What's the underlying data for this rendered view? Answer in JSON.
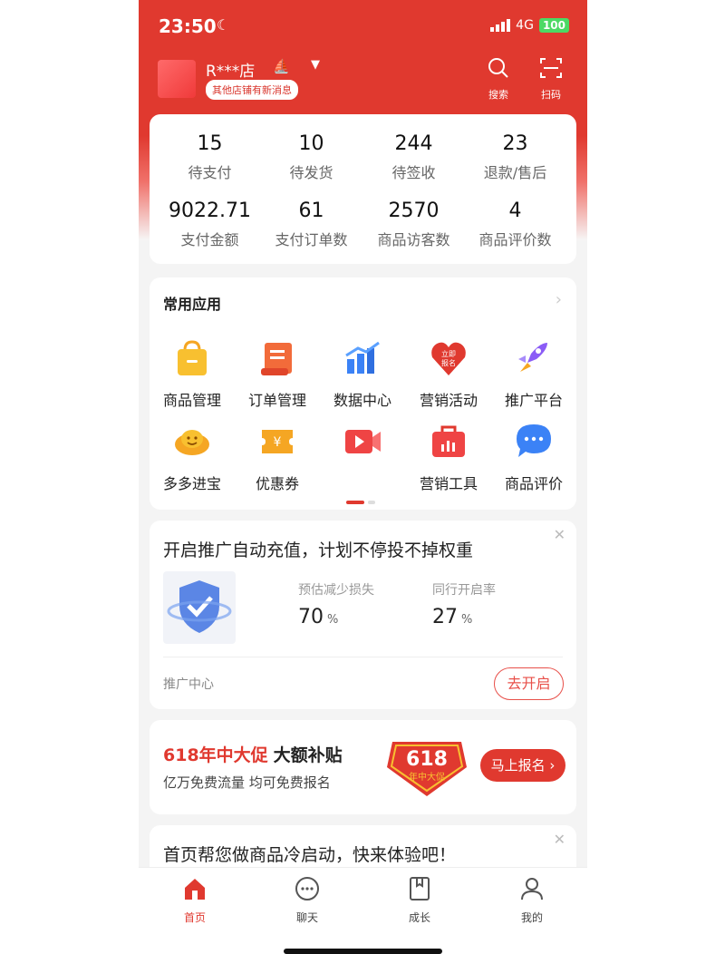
{
  "status_bar": {
    "time": "23:50",
    "network": "4G",
    "battery": "100"
  },
  "header": {
    "shop_name": "R***店",
    "shop_tag": "其他店铺有新消息",
    "search_label": "搜索",
    "scan_label": "扫码"
  },
  "stats": [
    {
      "value": "15",
      "label": "待支付"
    },
    {
      "value": "10",
      "label": "待发货"
    },
    {
      "value": "244",
      "label": "待签收"
    },
    {
      "value": "23",
      "label": "退款/售后"
    },
    {
      "value": "9022.71",
      "label": "支付金额"
    },
    {
      "value": "61",
      "label": "支付订单数"
    },
    {
      "value": "2570",
      "label": "商品访客数"
    },
    {
      "value": "4",
      "label": "商品评价数"
    }
  ],
  "apps": {
    "title": "常用应用",
    "items": [
      {
        "label": "商品管理",
        "icon": "shopping-bag-icon"
      },
      {
        "label": "订单管理",
        "icon": "receipt-icon"
      },
      {
        "label": "数据中心",
        "icon": "bar-chart-icon"
      },
      {
        "label": "营销活动",
        "icon": "signup-heart-icon",
        "badge": "立即报名"
      },
      {
        "label": "推广平台",
        "icon": "rocket-icon"
      },
      {
        "label": "多多进宝",
        "icon": "gold-ingot-icon"
      },
      {
        "label": "优惠券",
        "icon": "coupon-icon"
      },
      {
        "label": "",
        "icon": "video-icon"
      },
      {
        "label": "营销工具",
        "icon": "toolbox-icon"
      },
      {
        "label": "商品评价",
        "icon": "chat-bubble-icon"
      }
    ]
  },
  "promo": {
    "headline": "开启推广自动充值，计划不停投不掉权重",
    "metric1_label": "预估减少损失",
    "metric1_value": "70",
    "metric1_unit": "%",
    "metric2_label": "同行开启率",
    "metric2_value": "27",
    "metric2_unit": "%",
    "footer": "推广中心",
    "button": "去开启"
  },
  "banner": {
    "title_red": "618年中大促",
    "title_black": "大额补贴",
    "subtitle": "亿万免费流量 均可免费报名",
    "badge_number": "618",
    "badge_text": "年中大促",
    "button": "马上报名"
  },
  "notice": {
    "text": "首页帮您做商品冷启动，快来体验吧！"
  },
  "tabs": [
    {
      "label": "首页",
      "icon": "home-icon",
      "active": true
    },
    {
      "label": "聊天",
      "icon": "chat-icon"
    },
    {
      "label": "成长",
      "icon": "growth-book-icon"
    },
    {
      "label": "我的",
      "icon": "person-icon"
    }
  ],
  "colors": {
    "brand_red": "#e0392f",
    "accent_blue": "#3b82f6",
    "accent_orange": "#f5a623"
  }
}
